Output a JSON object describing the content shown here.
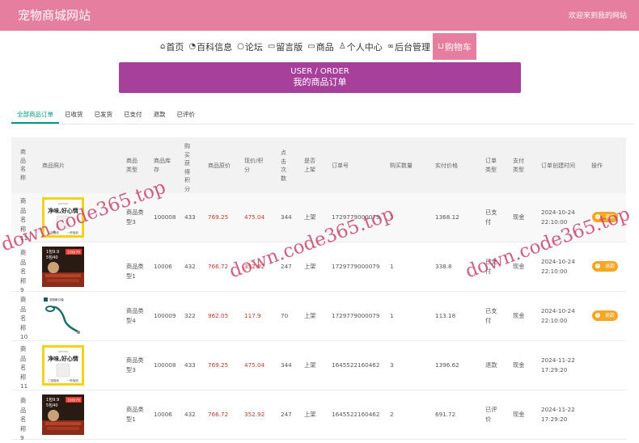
{
  "header": {
    "site_title": "宠物商城网站",
    "welcome": "欢迎来到我的网站"
  },
  "nav": [
    {
      "icon": "⌂",
      "label": "首页"
    },
    {
      "icon": "◔",
      "label": "百科信息"
    },
    {
      "icon": "○",
      "label": "论坛"
    },
    {
      "icon": "▭",
      "label": "留言版"
    },
    {
      "icon": "▭",
      "label": "商品"
    },
    {
      "icon": "♙",
      "label": "个人中心"
    },
    {
      "icon": "∞",
      "label": "后台管理"
    },
    {
      "icon": "⊔",
      "label": "购物车"
    }
  ],
  "banner": {
    "en": "USER / ORDER",
    "cn": "我的商品订单"
  },
  "tabs": [
    "全部商品订单",
    "已收货",
    "已发货",
    "已支付",
    "退款",
    "已评价"
  ],
  "headers": {
    "name": "商品名称",
    "image": "商品照片",
    "type": "商品类型",
    "stock": "商品库存",
    "points": "购买获得积分",
    "orig": "商品原价",
    "price": "现价/积分",
    "clicks": "点击次数",
    "onshelf": "是否上架",
    "order_no": "订单号",
    "qty": "购买数量",
    "paid": "实付价格",
    "order_type": "订单类型",
    "pay_type": "支付类型",
    "created": "订单创建时间",
    "action": "操作"
  },
  "rows": [
    {
      "name": "商品名称11",
      "img": "product-b",
      "type": "商品类型3",
      "stock": "100008",
      "points": "433",
      "orig": "769.25",
      "price": "475.04",
      "clicks": "344",
      "onshelf": "上架",
      "order_no": "1729779000079",
      "qty": "3",
      "paid": "1368.12",
      "order_type": "已支付",
      "pay_type": "现金",
      "date": "2024-10-24",
      "time": "22:10:00",
      "action": "退款"
    },
    {
      "name": "商品名称9",
      "img": "product-a",
      "type": "商品类型1",
      "stock": "10006",
      "points": "432",
      "orig": "766.72",
      "price": "352.92",
      "clicks": "247",
      "onshelf": "上架",
      "order_no": "1729779000079",
      "qty": "1",
      "paid": "338.8",
      "order_type": "已支付",
      "pay_type": "现金",
      "date": "2024-10-24",
      "time": "22:10:00",
      "action": "退款"
    },
    {
      "name": "商品名称10",
      "img": "product-c",
      "type": "商品类型4",
      "stock": "100009",
      "points": "322",
      "orig": "962.05",
      "price": "117.9",
      "clicks": "70",
      "onshelf": "上架",
      "order_no": "1729779000079",
      "qty": "1",
      "paid": "113.18",
      "order_type": "已支付",
      "pay_type": "现金",
      "date": "2024-10-24",
      "time": "22:10:00",
      "action": "退款"
    },
    {
      "name": "商品名称11",
      "img": "product-b",
      "type": "商品类型3",
      "stock": "100008",
      "points": "433",
      "orig": "769.25",
      "price": "475.04",
      "clicks": "344",
      "onshelf": "上架",
      "order_no": "1645522160462",
      "qty": "3",
      "paid": "1396.62",
      "order_type": "退款",
      "pay_type": "现金",
      "date": "2024-11-22",
      "time": "17:29:20",
      "action": ""
    },
    {
      "name": "商品名称9",
      "img": "product-a",
      "type": "商品类型1",
      "stock": "10006",
      "points": "432",
      "orig": "766.72",
      "price": "352.92",
      "clicks": "247",
      "onshelf": "上架",
      "order_no": "1645522160462",
      "qty": "2",
      "paid": "691.72",
      "order_type": "已评价",
      "pay_type": "现金",
      "date": "2024-11-22",
      "time": "17:29:20",
      "action": ""
    }
  ],
  "product_images": {
    "product_a": {
      "line1": "1包9.9",
      "line2": "5包40",
      "badge": "10包70"
    },
    "product_b": {
      "top": "pethoo",
      "headline": "净味,好心情",
      "line1": "三倍吸收",
      "line2": "一秒吸收"
    },
    "product_c": {
      "brand": "宠物牵引绳"
    }
  },
  "watermark": "down.code365.top",
  "colors": {
    "topbar": "#e67f9f",
    "banner": "#a6409a",
    "active_tab": "#009688",
    "price_red": "#c0392b",
    "refund_button": "#f5a623"
  }
}
